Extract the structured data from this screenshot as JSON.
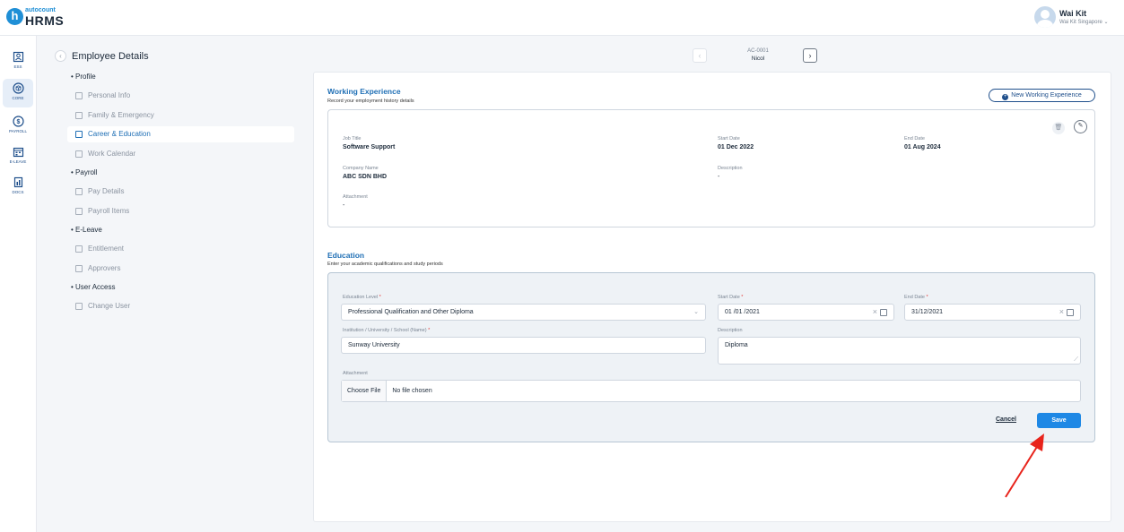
{
  "header": {
    "logo_small": "autocount",
    "logo_big": "HRMS",
    "user_name": "Wai Kit",
    "user_company": "Wai Kit Singapore ⌄"
  },
  "rail": [
    {
      "label": "ESS",
      "icon": "ess-icon",
      "active": false
    },
    {
      "label": "CORE",
      "icon": "cube-icon",
      "active": true
    },
    {
      "label": "PAYROLL",
      "icon": "dollar-icon",
      "active": false
    },
    {
      "label": "E-LEAVE",
      "icon": "calendar-icon",
      "active": false
    },
    {
      "label": "DOCS",
      "icon": "docs-icon",
      "active": false
    }
  ],
  "page": {
    "title": "Employee Details",
    "employee_code": "AC-0001",
    "employee_name": "Nicol"
  },
  "menu": {
    "profile": "Profile",
    "personal_info": "Personal Info",
    "family": "Family & Emergency",
    "career": "Career & Education",
    "work_calendar": "Work Calendar",
    "payroll": "Payroll",
    "pay_details": "Pay Details",
    "payroll_items": "Payroll Items",
    "eleave": "E-Leave",
    "entitlement": "Entitlement",
    "approvers": "Approvers",
    "user_access": "User Access",
    "change_user": "Change User"
  },
  "working_experience": {
    "title": "Working Experience",
    "subtitle": "Record your employment history details",
    "new_button": "New Working Experience",
    "job_title_label": "Job Title",
    "job_title": "Software Support",
    "start_date_label": "Start Date",
    "start_date": "01 Dec 2022",
    "end_date_label": "End Date",
    "end_date": "01 Aug 2024",
    "company_label": "Company Name",
    "company": "ABC SDN BHD",
    "description_label": "Description",
    "description": "-",
    "attachment_label": "Attachment",
    "attachment": "-"
  },
  "education": {
    "title": "Education",
    "subtitle": "Enter your academic qualifications and study periods",
    "level_label": "Education Level",
    "level_value": "Professional Qualification and Other Diploma",
    "start_label": "Start Date",
    "start_value": "01 /01 /2021",
    "end_label": "End Date",
    "end_value": "31/12/2021",
    "institution_label": "Institution / University / School (Name)",
    "institution_value": "Sunway University",
    "description_label": "Description",
    "description_value": "Diploma",
    "attachment_label": "Attachment",
    "choose_file": "Choose File",
    "no_file": "No file chosen",
    "required_mark": "*",
    "cancel": "Cancel",
    "save": "Save"
  },
  "colors": {
    "accent": "#1f6fb5",
    "save": "#1e88e5",
    "arrow": "#e8241c"
  }
}
